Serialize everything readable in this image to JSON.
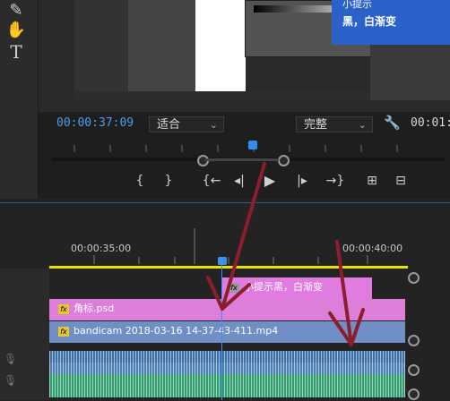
{
  "program_monitor": {
    "timecode": "00:00:37:09",
    "fit_label": "适合",
    "quality_label": "完整",
    "end_timecode": "00:01:",
    "overlay": {
      "title_line1": "小提示",
      "title_line2": "黑，白渐变"
    }
  },
  "tools": [
    "pen-tool",
    "hand-tool",
    "type-tool"
  ],
  "tool_type_label": "T",
  "transport": {
    "mark_in": "{",
    "mark_out": "}",
    "go_to_in": "{←",
    "step_back": "◂|",
    "play": "▶",
    "step_forward": "|▸",
    "go_to_out": "→}",
    "lift": "⊞",
    "extract": "⊟"
  },
  "timeline": {
    "ruler_labels": [
      "00:00:35:00",
      "00:00:40:00"
    ],
    "clips": {
      "title_clip": "小提示黑，白渐变",
      "psd_clip": "角标.psd",
      "video_clip": "bandicam 2018-03-16 14-37-43-411.mp4"
    },
    "fx_badge": "fx"
  },
  "colors": {
    "accent_blue": "#2a62c9",
    "timecode_blue": "#4a9fe8",
    "title_clip": "#e07be0",
    "psd_clip": "#dd7fd9",
    "video_clip": "#6f8fc6",
    "audio_clip_1": "#3a6fa8",
    "audio_clip_2": "#2e9e6f",
    "annotation_arrow": "#8c1d2a"
  }
}
